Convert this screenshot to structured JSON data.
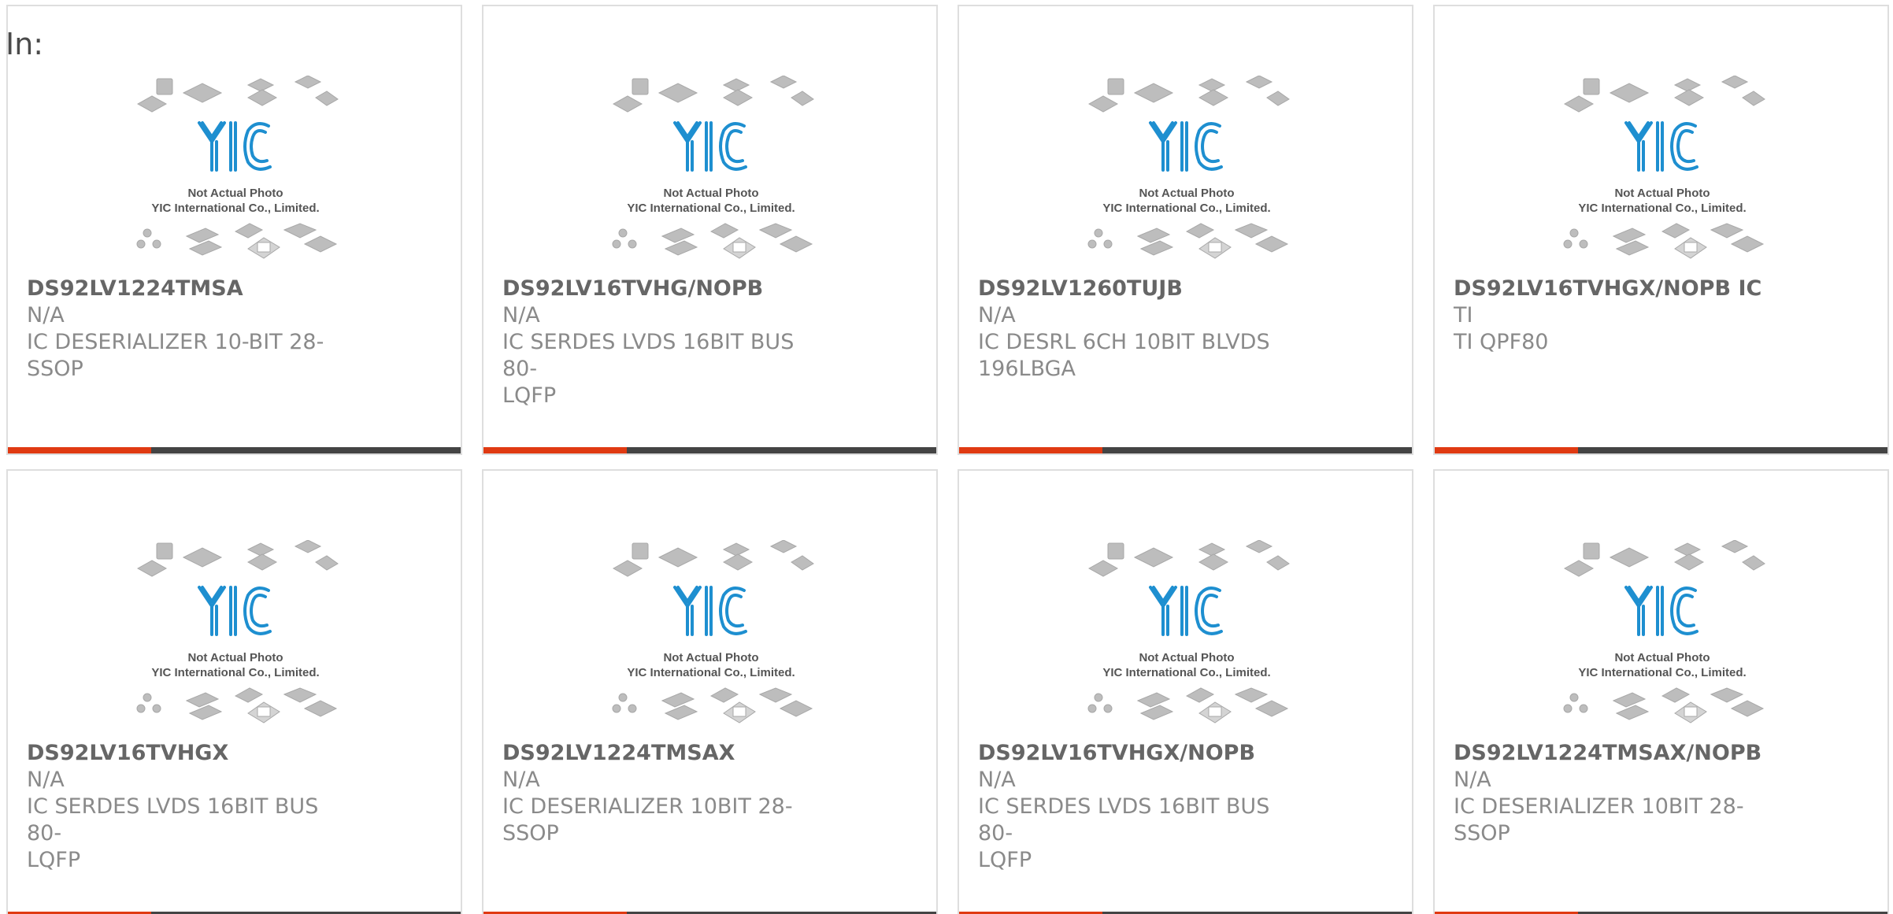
{
  "header": {
    "in_label": "In:"
  },
  "thumbnail": {
    "logo_text": "YIC",
    "caption_line1": "Not Actual Photo",
    "caption_line2": "YIC International Co., Limited."
  },
  "colors": {
    "accent": "#e03a12",
    "bar": "#444444",
    "logo": "#1e8fd0"
  },
  "products": [
    {
      "part": "DS92LV1224TMSA",
      "mfr": "N/A",
      "desc": [
        "IC DESERIALIZER 10-BIT 28-",
        "SSOP"
      ]
    },
    {
      "part": "DS92LV16TVHG/NOPB",
      "mfr": "N/A",
      "desc": [
        "IC SERDES LVDS 16BIT BUS 80-",
        "LQFP"
      ]
    },
    {
      "part": "DS92LV1260TUJB",
      "mfr": "N/A",
      "desc": [
        "IC DESRL 6CH 10BIT BLVDS",
        "196LBGA"
      ]
    },
    {
      "part": "DS92LV16TVHGX/NOPB IC",
      "mfr": "TI",
      "desc": [
        "TI QPF80"
      ]
    },
    {
      "part": "DS92LV16TVHGX",
      "mfr": "N/A",
      "desc": [
        "IC SERDES LVDS 16BIT BUS 80-",
        "LQFP"
      ]
    },
    {
      "part": "DS92LV1224TMSAX",
      "mfr": "N/A",
      "desc": [
        "IC DESERIALIZER 10BIT 28-SSOP"
      ]
    },
    {
      "part": "DS92LV16TVHGX/NOPB",
      "mfr": "N/A",
      "desc": [
        "IC SERDES LVDS 16BIT BUS 80-",
        "LQFP"
      ]
    },
    {
      "part": "DS92LV1224TMSAX/NOPB",
      "mfr": "N/A",
      "desc": [
        "IC DESERIALIZER 10BIT 28-SSOP"
      ]
    }
  ]
}
